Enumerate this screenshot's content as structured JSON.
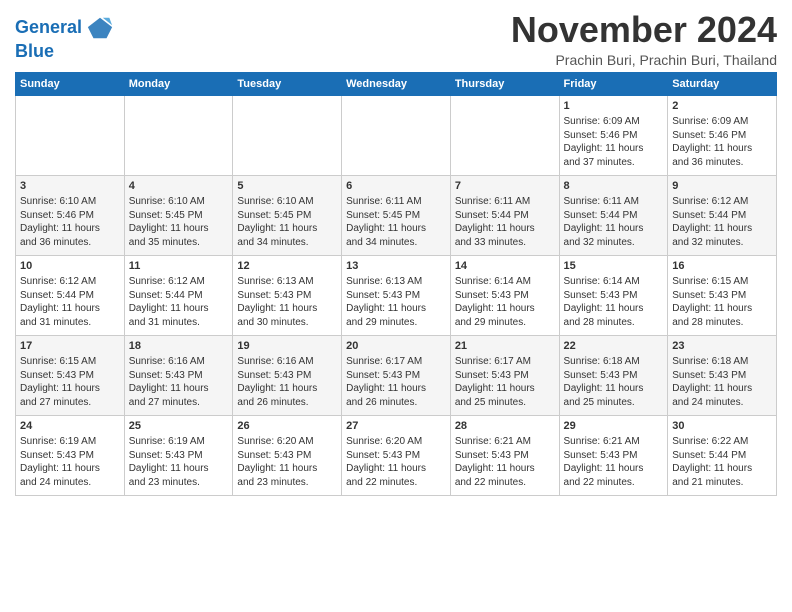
{
  "header": {
    "logo_line1": "General",
    "logo_line2": "Blue",
    "month": "November 2024",
    "location": "Prachin Buri, Prachin Buri, Thailand"
  },
  "weekdays": [
    "Sunday",
    "Monday",
    "Tuesday",
    "Wednesday",
    "Thursday",
    "Friday",
    "Saturday"
  ],
  "weeks": [
    [
      {
        "day": "",
        "info": ""
      },
      {
        "day": "",
        "info": ""
      },
      {
        "day": "",
        "info": ""
      },
      {
        "day": "",
        "info": ""
      },
      {
        "day": "",
        "info": ""
      },
      {
        "day": "1",
        "info": "Sunrise: 6:09 AM\nSunset: 5:46 PM\nDaylight: 11 hours\nand 37 minutes."
      },
      {
        "day": "2",
        "info": "Sunrise: 6:09 AM\nSunset: 5:46 PM\nDaylight: 11 hours\nand 36 minutes."
      }
    ],
    [
      {
        "day": "3",
        "info": "Sunrise: 6:10 AM\nSunset: 5:46 PM\nDaylight: 11 hours\nand 36 minutes."
      },
      {
        "day": "4",
        "info": "Sunrise: 6:10 AM\nSunset: 5:45 PM\nDaylight: 11 hours\nand 35 minutes."
      },
      {
        "day": "5",
        "info": "Sunrise: 6:10 AM\nSunset: 5:45 PM\nDaylight: 11 hours\nand 34 minutes."
      },
      {
        "day": "6",
        "info": "Sunrise: 6:11 AM\nSunset: 5:45 PM\nDaylight: 11 hours\nand 34 minutes."
      },
      {
        "day": "7",
        "info": "Sunrise: 6:11 AM\nSunset: 5:44 PM\nDaylight: 11 hours\nand 33 minutes."
      },
      {
        "day": "8",
        "info": "Sunrise: 6:11 AM\nSunset: 5:44 PM\nDaylight: 11 hours\nand 32 minutes."
      },
      {
        "day": "9",
        "info": "Sunrise: 6:12 AM\nSunset: 5:44 PM\nDaylight: 11 hours\nand 32 minutes."
      }
    ],
    [
      {
        "day": "10",
        "info": "Sunrise: 6:12 AM\nSunset: 5:44 PM\nDaylight: 11 hours\nand 31 minutes."
      },
      {
        "day": "11",
        "info": "Sunrise: 6:12 AM\nSunset: 5:44 PM\nDaylight: 11 hours\nand 31 minutes."
      },
      {
        "day": "12",
        "info": "Sunrise: 6:13 AM\nSunset: 5:43 PM\nDaylight: 11 hours\nand 30 minutes."
      },
      {
        "day": "13",
        "info": "Sunrise: 6:13 AM\nSunset: 5:43 PM\nDaylight: 11 hours\nand 29 minutes."
      },
      {
        "day": "14",
        "info": "Sunrise: 6:14 AM\nSunset: 5:43 PM\nDaylight: 11 hours\nand 29 minutes."
      },
      {
        "day": "15",
        "info": "Sunrise: 6:14 AM\nSunset: 5:43 PM\nDaylight: 11 hours\nand 28 minutes."
      },
      {
        "day": "16",
        "info": "Sunrise: 6:15 AM\nSunset: 5:43 PM\nDaylight: 11 hours\nand 28 minutes."
      }
    ],
    [
      {
        "day": "17",
        "info": "Sunrise: 6:15 AM\nSunset: 5:43 PM\nDaylight: 11 hours\nand 27 minutes."
      },
      {
        "day": "18",
        "info": "Sunrise: 6:16 AM\nSunset: 5:43 PM\nDaylight: 11 hours\nand 27 minutes."
      },
      {
        "day": "19",
        "info": "Sunrise: 6:16 AM\nSunset: 5:43 PM\nDaylight: 11 hours\nand 26 minutes."
      },
      {
        "day": "20",
        "info": "Sunrise: 6:17 AM\nSunset: 5:43 PM\nDaylight: 11 hours\nand 26 minutes."
      },
      {
        "day": "21",
        "info": "Sunrise: 6:17 AM\nSunset: 5:43 PM\nDaylight: 11 hours\nand 25 minutes."
      },
      {
        "day": "22",
        "info": "Sunrise: 6:18 AM\nSunset: 5:43 PM\nDaylight: 11 hours\nand 25 minutes."
      },
      {
        "day": "23",
        "info": "Sunrise: 6:18 AM\nSunset: 5:43 PM\nDaylight: 11 hours\nand 24 minutes."
      }
    ],
    [
      {
        "day": "24",
        "info": "Sunrise: 6:19 AM\nSunset: 5:43 PM\nDaylight: 11 hours\nand 24 minutes."
      },
      {
        "day": "25",
        "info": "Sunrise: 6:19 AM\nSunset: 5:43 PM\nDaylight: 11 hours\nand 23 minutes."
      },
      {
        "day": "26",
        "info": "Sunrise: 6:20 AM\nSunset: 5:43 PM\nDaylight: 11 hours\nand 23 minutes."
      },
      {
        "day": "27",
        "info": "Sunrise: 6:20 AM\nSunset: 5:43 PM\nDaylight: 11 hours\nand 22 minutes."
      },
      {
        "day": "28",
        "info": "Sunrise: 6:21 AM\nSunset: 5:43 PM\nDaylight: 11 hours\nand 22 minutes."
      },
      {
        "day": "29",
        "info": "Sunrise: 6:21 AM\nSunset: 5:43 PM\nDaylight: 11 hours\nand 22 minutes."
      },
      {
        "day": "30",
        "info": "Sunrise: 6:22 AM\nSunset: 5:44 PM\nDaylight: 11 hours\nand 21 minutes."
      }
    ]
  ]
}
